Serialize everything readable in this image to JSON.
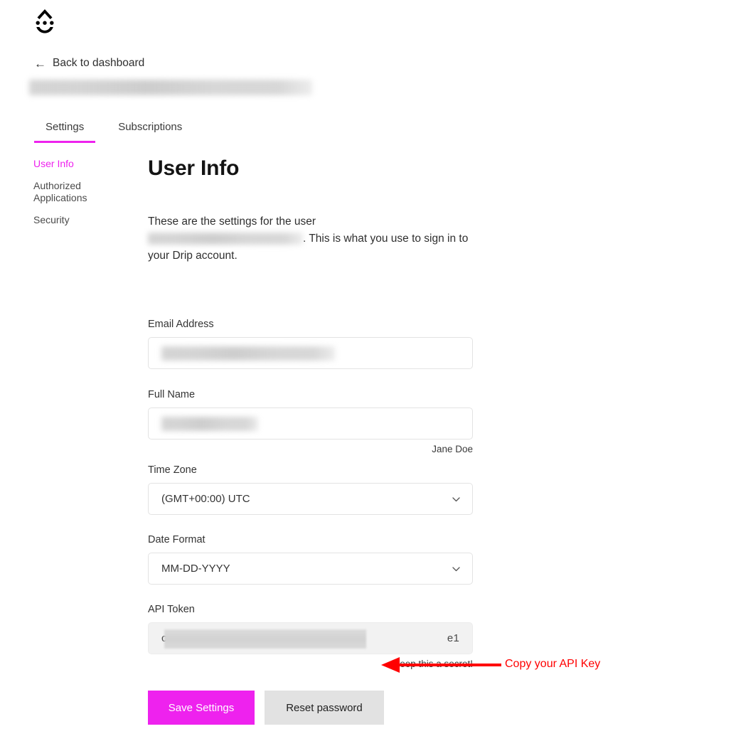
{
  "brand": {
    "logo_icon": "drip-droplet-logo"
  },
  "nav": {
    "back_label": "Back to dashboard",
    "back_icon": "arrow-left-icon",
    "account_title_redacted": ""
  },
  "tabs": [
    {
      "label": "Settings",
      "active": true
    },
    {
      "label": "Subscriptions",
      "active": false
    }
  ],
  "sidebar": {
    "items": [
      {
        "label": "User Info",
        "active": true
      },
      {
        "label": "Authorized Applications",
        "active": false
      },
      {
        "label": "Security",
        "active": false
      }
    ]
  },
  "main": {
    "title": "User Info",
    "intro_before": "These are the settings for the user",
    "intro_after": ". This is what you use to sign in to your Drip account."
  },
  "form": {
    "email": {
      "label": "Email Address",
      "value": "",
      "redacted": true
    },
    "full_name": {
      "label": "Full Name",
      "value": "",
      "redacted": true,
      "hint": "Jane Doe"
    },
    "time_zone": {
      "label": "Time Zone",
      "value": "(GMT+00:00) UTC",
      "caret_icon": "chevron-down-icon"
    },
    "date_format": {
      "label": "Date Format",
      "value": "MM-DD-YYYY",
      "caret_icon": "chevron-down-icon"
    },
    "api_token": {
      "label": "API Token",
      "value_prefix": "c",
      "value_suffix": "e1",
      "hint": "Keep this a secret!",
      "disabled": true
    }
  },
  "buttons": {
    "save": "Save Settings",
    "reset_password": "Reset password"
  },
  "annotation": {
    "text": "Copy your API Key",
    "icon": "arrow-left-annotation",
    "color": "#ff0000"
  },
  "colors": {
    "accent": "#ee22ee",
    "annotation_red": "#ff0000",
    "text": "#2b2b2b",
    "border": "#e3e3e3",
    "disabled_bg": "#f2f2f2",
    "secondary_button_bg": "#e2e2e2"
  }
}
